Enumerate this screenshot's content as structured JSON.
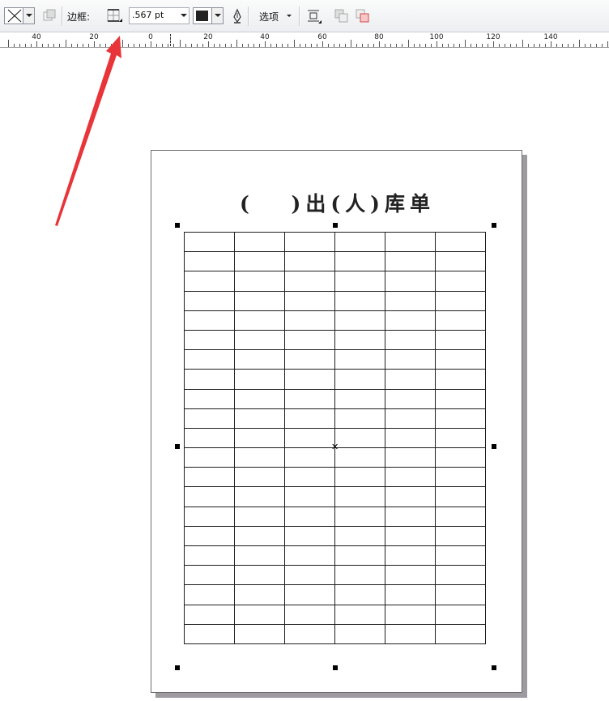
{
  "toolbar": {
    "border_label": "边框:",
    "outline_width": ".567 pt",
    "options_label": "选项",
    "outline_color": "#222222"
  },
  "ruler": {
    "labels": [
      "40",
      "20",
      "0",
      "20",
      "40",
      "60",
      "80",
      "100",
      "120",
      "140"
    ]
  },
  "document": {
    "title": "(　 )出(人)库单",
    "table_rows": 21,
    "table_cols": 6
  },
  "colors": {
    "annotation_arrow": "#e8353a",
    "page_shadow": "#9d9aa0",
    "toolbar_bg": "#eceef1"
  },
  "icons": {
    "border_style": "x-cross-icon",
    "disabled_action": "disabled-arrange-icon",
    "border_grid": "table-border-icon",
    "pen": "pen-nib-icon",
    "wrap": "text-wrap-icon",
    "to_front": "bring-forward-icon",
    "to_back": "send-backward-icon"
  }
}
